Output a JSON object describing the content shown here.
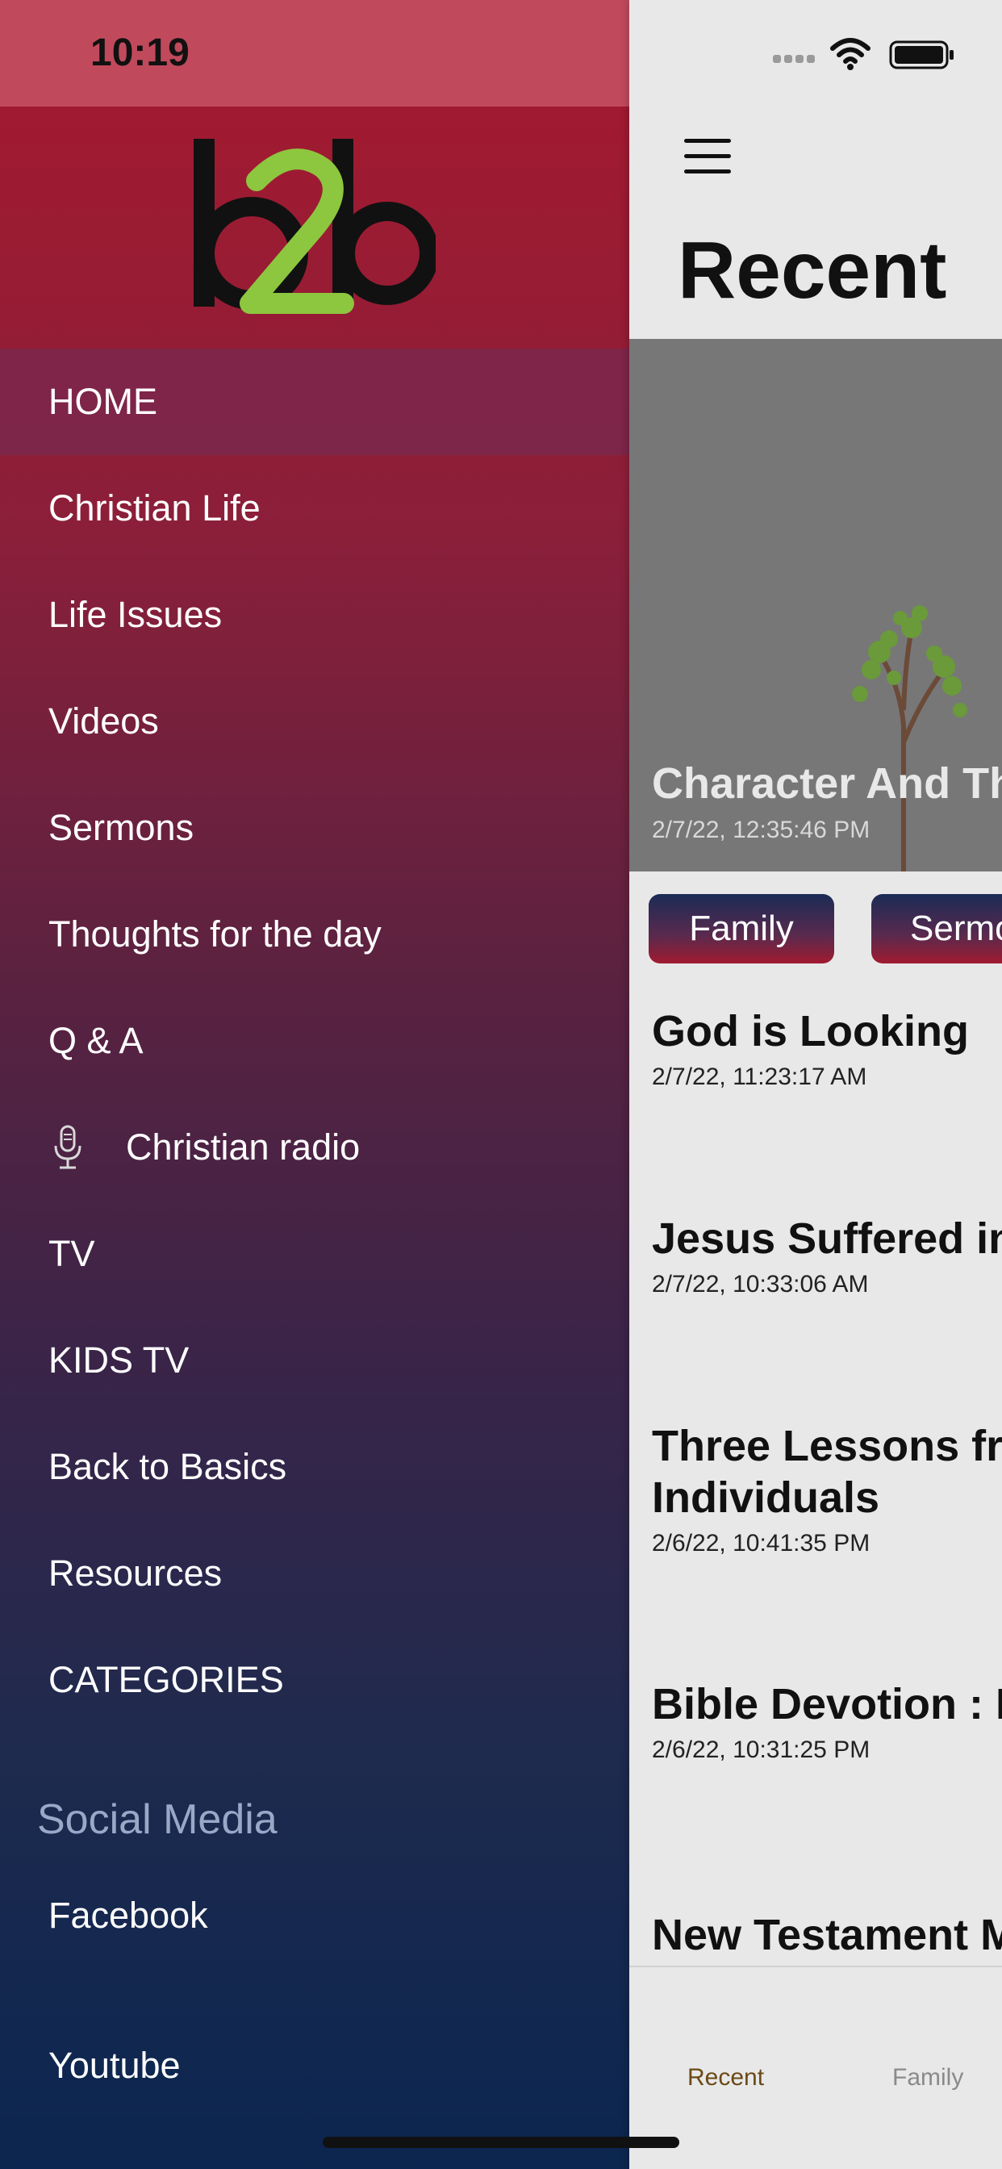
{
  "status_bar": {
    "time": "10:19"
  },
  "drawer": {
    "logo_text": "b2b",
    "menu": [
      {
        "label": "HOME",
        "active": true
      },
      {
        "label": "Christian Life"
      },
      {
        "label": "Life Issues"
      },
      {
        "label": "Videos"
      },
      {
        "label": "Sermons"
      },
      {
        "label": "Thoughts for the day"
      },
      {
        "label": "Q & A"
      },
      {
        "label": "Christian radio",
        "icon": "microphone-icon"
      },
      {
        "label": "TV"
      },
      {
        "label": "KIDS TV"
      },
      {
        "label": "Back to Basics"
      },
      {
        "label": "Resources"
      },
      {
        "label": "CATEGORIES"
      }
    ],
    "social_heading": "Social Media",
    "social": [
      {
        "label": "Facebook"
      },
      {
        "label": "Youtube"
      }
    ]
  },
  "main": {
    "title": "Recent",
    "hero": {
      "title": "Character And Th",
      "date": "2/7/22, 12:35:46 PM"
    },
    "chips": [
      "Family",
      "Sermo"
    ],
    "articles": [
      {
        "title": "God is Looking",
        "date": "2/7/22, 11:23:17 AM"
      },
      {
        "title": "Jesus Suffered in",
        "date": "2/7/22, 10:33:06 AM"
      },
      {
        "title": "Three Lessons fro",
        "title2": "Individuals",
        "date": "2/6/22, 10:41:35 PM"
      },
      {
        "title": "Bible Devotion : P",
        "date": "2/6/22, 10:31:25 PM"
      },
      {
        "title": "New Testament M",
        "date": ""
      }
    ],
    "tabs": [
      "Recent",
      "Family"
    ]
  },
  "colors": {
    "drawer_top": "#a6192e",
    "drawer_bottom": "#0b2650",
    "logo_green": "#8dc63f",
    "tab_active": "#6b4a16",
    "tab_inactive": "#8a8a8a"
  }
}
